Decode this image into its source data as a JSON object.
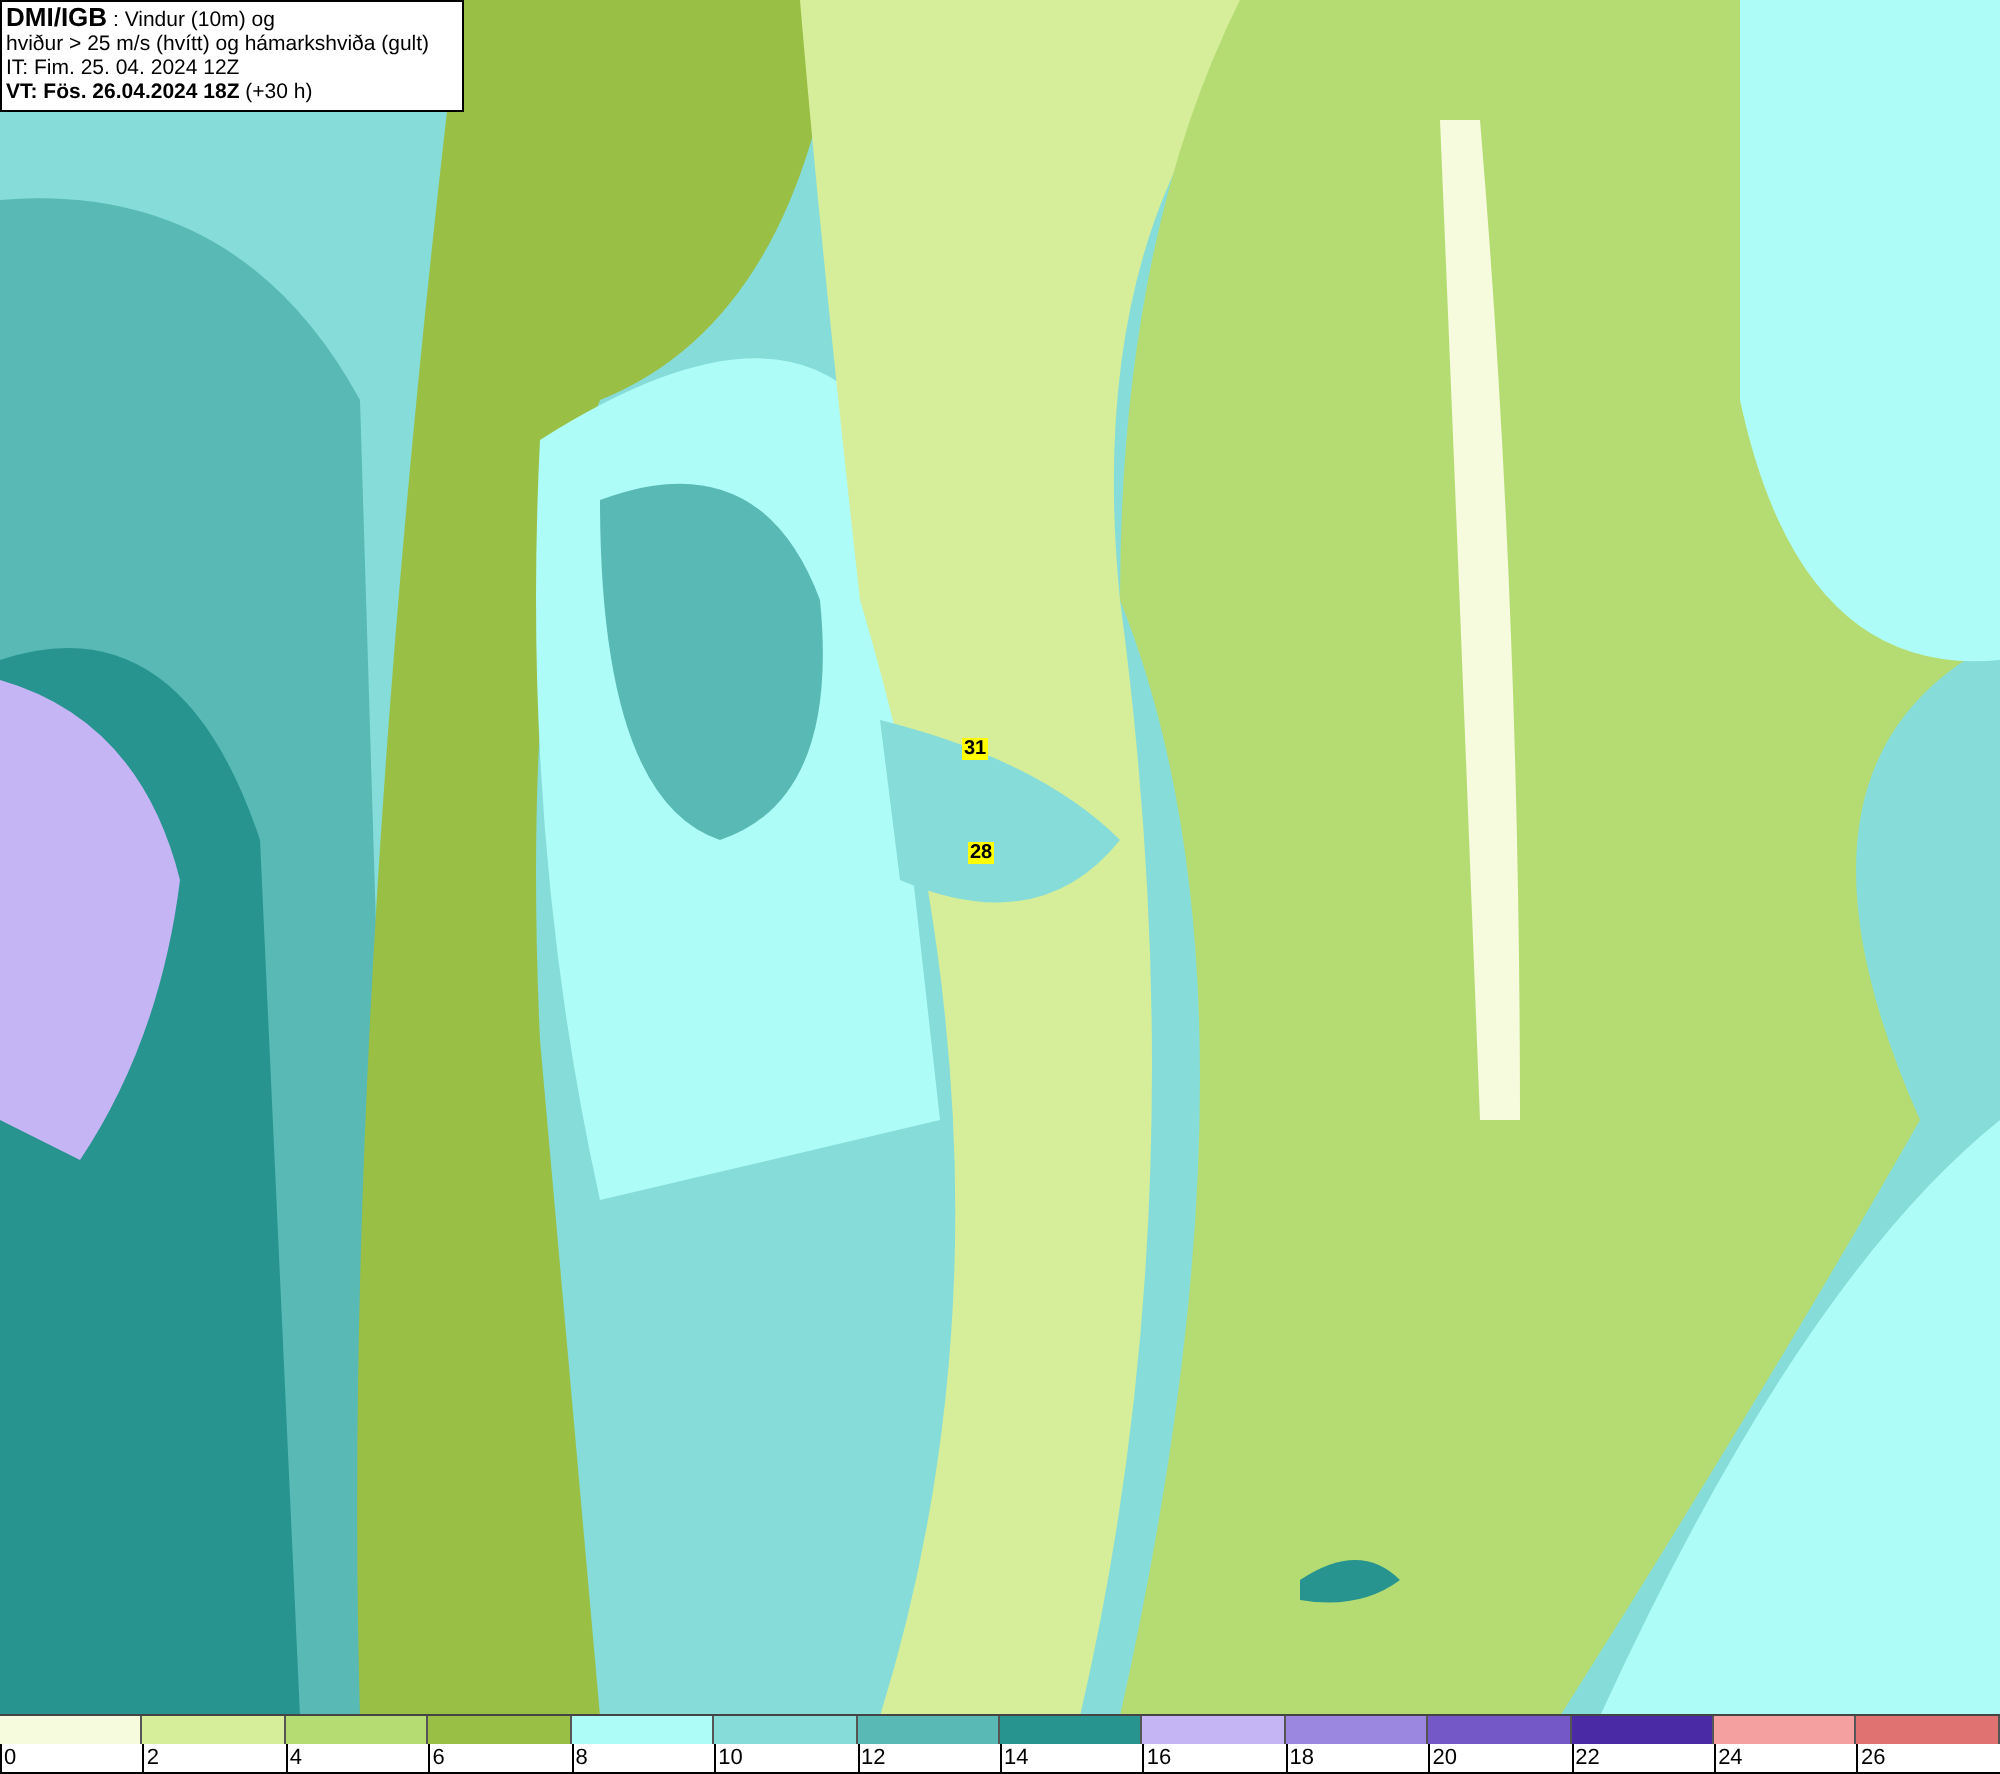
{
  "title_box": {
    "lines": [
      "**DMI/IGB** : Vindur (10m) og",
      "hviður > 25 m/s (hvítt) og hámarkshviða (gult)",
      "IT: Fim. 25. 04. 2024 12Z",
      "**VT: Fös. 26.04.2024 18Z** (+30 h)"
    ]
  },
  "map": {
    "gust_labels": [
      "31",
      "28"
    ]
  },
  "legend": [
    {
      "label": "0",
      "color": "#f5fbdc"
    },
    {
      "label": "2",
      "color": "#d6ee9a"
    },
    {
      "label": "4",
      "color": "#b5dc73"
    },
    {
      "label": "6",
      "color": "#9abf45"
    },
    {
      "label": "8",
      "color": "#aefcf8"
    },
    {
      "label": "10",
      "color": "#86dcd8"
    },
    {
      "label": "12",
      "color": "#58b9b5"
    },
    {
      "label": "14",
      "color": "#27948f"
    },
    {
      "label": "16",
      "color": "#c5b5f5"
    },
    {
      "label": "18",
      "color": "#9c87e0"
    },
    {
      "label": "20",
      "color": "#7458c8"
    },
    {
      "label": "22",
      "color": "#4a2aa5"
    },
    {
      "label": "24",
      "color": "#f5a0a0"
    },
    {
      "label": "26",
      "color": "#e07272"
    }
  ]
}
